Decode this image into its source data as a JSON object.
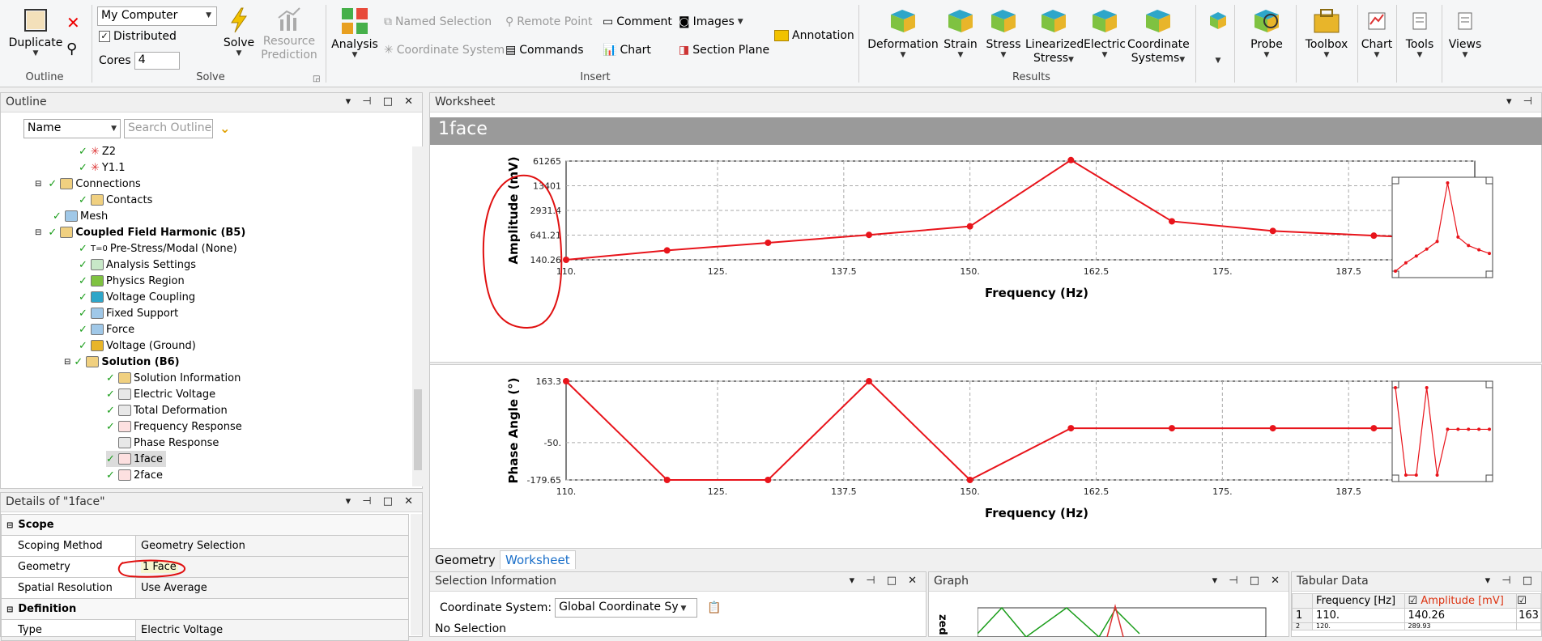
{
  "ribbon": {
    "outline_group": {
      "duplicate_label": "Duplicate",
      "group_label": "Outline"
    },
    "solve_group": {
      "computer_select": "My Computer",
      "distributed_label": "Distributed",
      "cores_label": "Cores",
      "cores_value": "4",
      "solve_label": "Solve",
      "resource_prediction_label": "Resource Prediction",
      "group_label": "Solve"
    },
    "insert_group": {
      "analysis_label": "Analysis",
      "named_selection": "Named Selection",
      "remote_point": "Remote Point",
      "comment": "Comment",
      "images": "Images",
      "annotation": "Annotation",
      "coordinate_system": "Coordinate System",
      "commands": "Commands",
      "chart": "Chart",
      "section_plane": "Section Plane",
      "group_label": "Insert"
    },
    "results_group": {
      "deformation": "Deformation",
      "strain": "Strain",
      "stress": "Stress",
      "linearized_stress_1": "Linearized",
      "linearized_stress_2": "Stress",
      "electric": "Electric",
      "coordinate_systems_1": "Coordinate",
      "coordinate_systems_2": "Systems",
      "group_label": "Results"
    },
    "tools_group": {
      "probe": "Probe",
      "toolbox": "Toolbox",
      "chart": "Chart",
      "tools": "Tools",
      "views": "Views"
    }
  },
  "outline": {
    "title": "Outline",
    "name_select": "Name",
    "search_placeholder": "Search Outline",
    "items": [
      {
        "label": "Z2"
      },
      {
        "label": "Y1.1"
      },
      {
        "label": "Connections"
      },
      {
        "label": "Contacts"
      },
      {
        "label": "Mesh"
      },
      {
        "label": "Coupled Field Harmonic (B5)"
      },
      {
        "label": "Pre-Stress/Modal (None)"
      },
      {
        "label": "Analysis Settings"
      },
      {
        "label": "Physics Region"
      },
      {
        "label": "Voltage Coupling"
      },
      {
        "label": "Fixed Support"
      },
      {
        "label": "Force"
      },
      {
        "label": "Voltage (Ground)"
      },
      {
        "label": "Solution (B6)"
      },
      {
        "label": "Solution Information"
      },
      {
        "label": "Electric Voltage"
      },
      {
        "label": "Total Deformation"
      },
      {
        "label": "Frequency Response"
      },
      {
        "label": "Phase Response"
      },
      {
        "label": "1face"
      },
      {
        "label": "2face"
      }
    ]
  },
  "details": {
    "title": "Details of \"1face\"",
    "scope_header": "Scope",
    "scoping_method_label": "Scoping Method",
    "scoping_method_value": "Geometry Selection",
    "geometry_label": "Geometry",
    "geometry_value": "1 Face",
    "spatial_label": "Spatial Resolution",
    "spatial_value": "Use Average",
    "definition_header": "Definition",
    "type_label": "Type",
    "type_value": "Electric Voltage"
  },
  "worksheet": {
    "title": "Worksheet",
    "heading": "1face",
    "tabs": [
      "Geometry",
      "Worksheet"
    ]
  },
  "selection_info": {
    "title": "Selection Information",
    "coord_label": "Coordinate System:",
    "coord_value": "Global Coordinate Sy",
    "no_selection": "No Selection"
  },
  "graph": {
    "title": "Graph",
    "partial_label": "zed"
  },
  "tabular": {
    "title": "Tabular Data",
    "col_freq": "Frequency [Hz]",
    "col_amp": "Amplitude [mV]",
    "row1_idx": "1",
    "row1_freq": "110.",
    "row1_amp": "140.26",
    "row1_phase": "163",
    "row2_idx": "2",
    "row2_freq": "120.",
    "row2_amp": "289.93"
  },
  "chart_data": [
    {
      "type": "line",
      "ylabel": "Amplitude (mV)",
      "xlabel": "Frequency (Hz)",
      "y_scale": "log",
      "x_ticks": [
        "110.",
        "125.",
        "137.5",
        "150.",
        "162.5",
        "175.",
        "187.5"
      ],
      "y_ticks": [
        "61265",
        "13401",
        "2931.4",
        "641.21",
        "140.26"
      ],
      "x": [
        110,
        120,
        130,
        140,
        150,
        160,
        170,
        180,
        190,
        200
      ],
      "y": [
        140.26,
        250,
        400,
        650,
        1100,
        65000,
        1500,
        830,
        620,
        480
      ],
      "xlim": [
        110,
        200
      ],
      "ylim": [
        140.26,
        61265
      ],
      "color": "#e8141b"
    },
    {
      "type": "line",
      "ylabel": "Phase Angle (°)",
      "xlabel": "Frequency (Hz)",
      "x_ticks": [
        "110.",
        "125.",
        "137.5",
        "150.",
        "162.5",
        "175.",
        "187.5"
      ],
      "y_ticks": [
        "163.3",
        "-50.",
        "-179.65"
      ],
      "x": [
        110,
        120,
        130,
        140,
        150,
        160,
        170,
        180,
        190,
        200
      ],
      "y": [
        163.3,
        -179.65,
        -179.65,
        163.3,
        -179.65,
        0,
        0,
        0,
        0,
        0
      ],
      "xlim": [
        110,
        200
      ],
      "ylim": [
        -179.65,
        163.3
      ],
      "color": "#e8141b"
    }
  ]
}
